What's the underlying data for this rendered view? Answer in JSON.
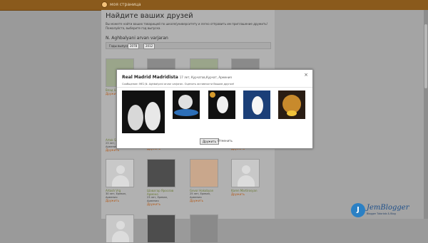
{
  "header": {
    "brand": "моя страница"
  },
  "page": {
    "title": "Найдите ваших друзей",
    "intro": "Вы можете найти ваших товарищей по школе/университету и легко отправить им приглашение дружить! Пожалуйста, выберите год выпуска.",
    "school_name": "N. Aghbalyani arvan varjaran",
    "filter": {
      "label": "Годы выпуска",
      "from": "2078",
      "to": "2012"
    }
  },
  "people": [
    {
      "name": "Влад Шляпов",
      "info": "",
      "add_label": "Дружить"
    },
    {
      "name": "",
      "info": "",
      "add_label": "Дружить"
    },
    {
      "name": "",
      "info": "",
      "add_label": "Дружить"
    },
    {
      "name": "",
      "info": "",
      "add_label": "Дружить"
    },
    {
      "name": "Artak Sagiravyan",
      "info": "23 лет, Ереван, Армения",
      "add_label": "Дружить"
    },
    {
      "name": "",
      "info": "",
      "add_label": "Дружить"
    },
    {
      "name": "",
      "info": "",
      "add_label": "Дружить"
    },
    {
      "name": "",
      "info": "",
      "add_label": "Дружить"
    },
    {
      "name": "Artash Vrg",
      "info": "30 лет, Ереван, Армения",
      "add_label": "Дружить"
    },
    {
      "name": "Шавагар Ярослав Армено",
      "info": "23 лет, Ереван, Армения",
      "add_label": "Дружить"
    },
    {
      "name": "Gevor Hakobyan",
      "info": "25 лет, Ереван, Армения",
      "add_label": "Дружить"
    },
    {
      "name": "Karen Martirosyan",
      "info": "",
      "add_label": "Дружить"
    }
  ],
  "modal": {
    "title": "Real Madrid Madridista",
    "subtitle": "17 лет, Курчатов,Курчат, Армения",
    "message": "Сообщение: ME2,N. Aghbalyani arvan varjaran. Оценить активности Вашим другом!",
    "add_button": "Дружить",
    "cancel_button": "Отменить",
    "close": "×"
  },
  "watermark": {
    "mark": "J",
    "line1": "JemBlogger",
    "line2": "Blogger Tutorials & Blog"
  }
}
